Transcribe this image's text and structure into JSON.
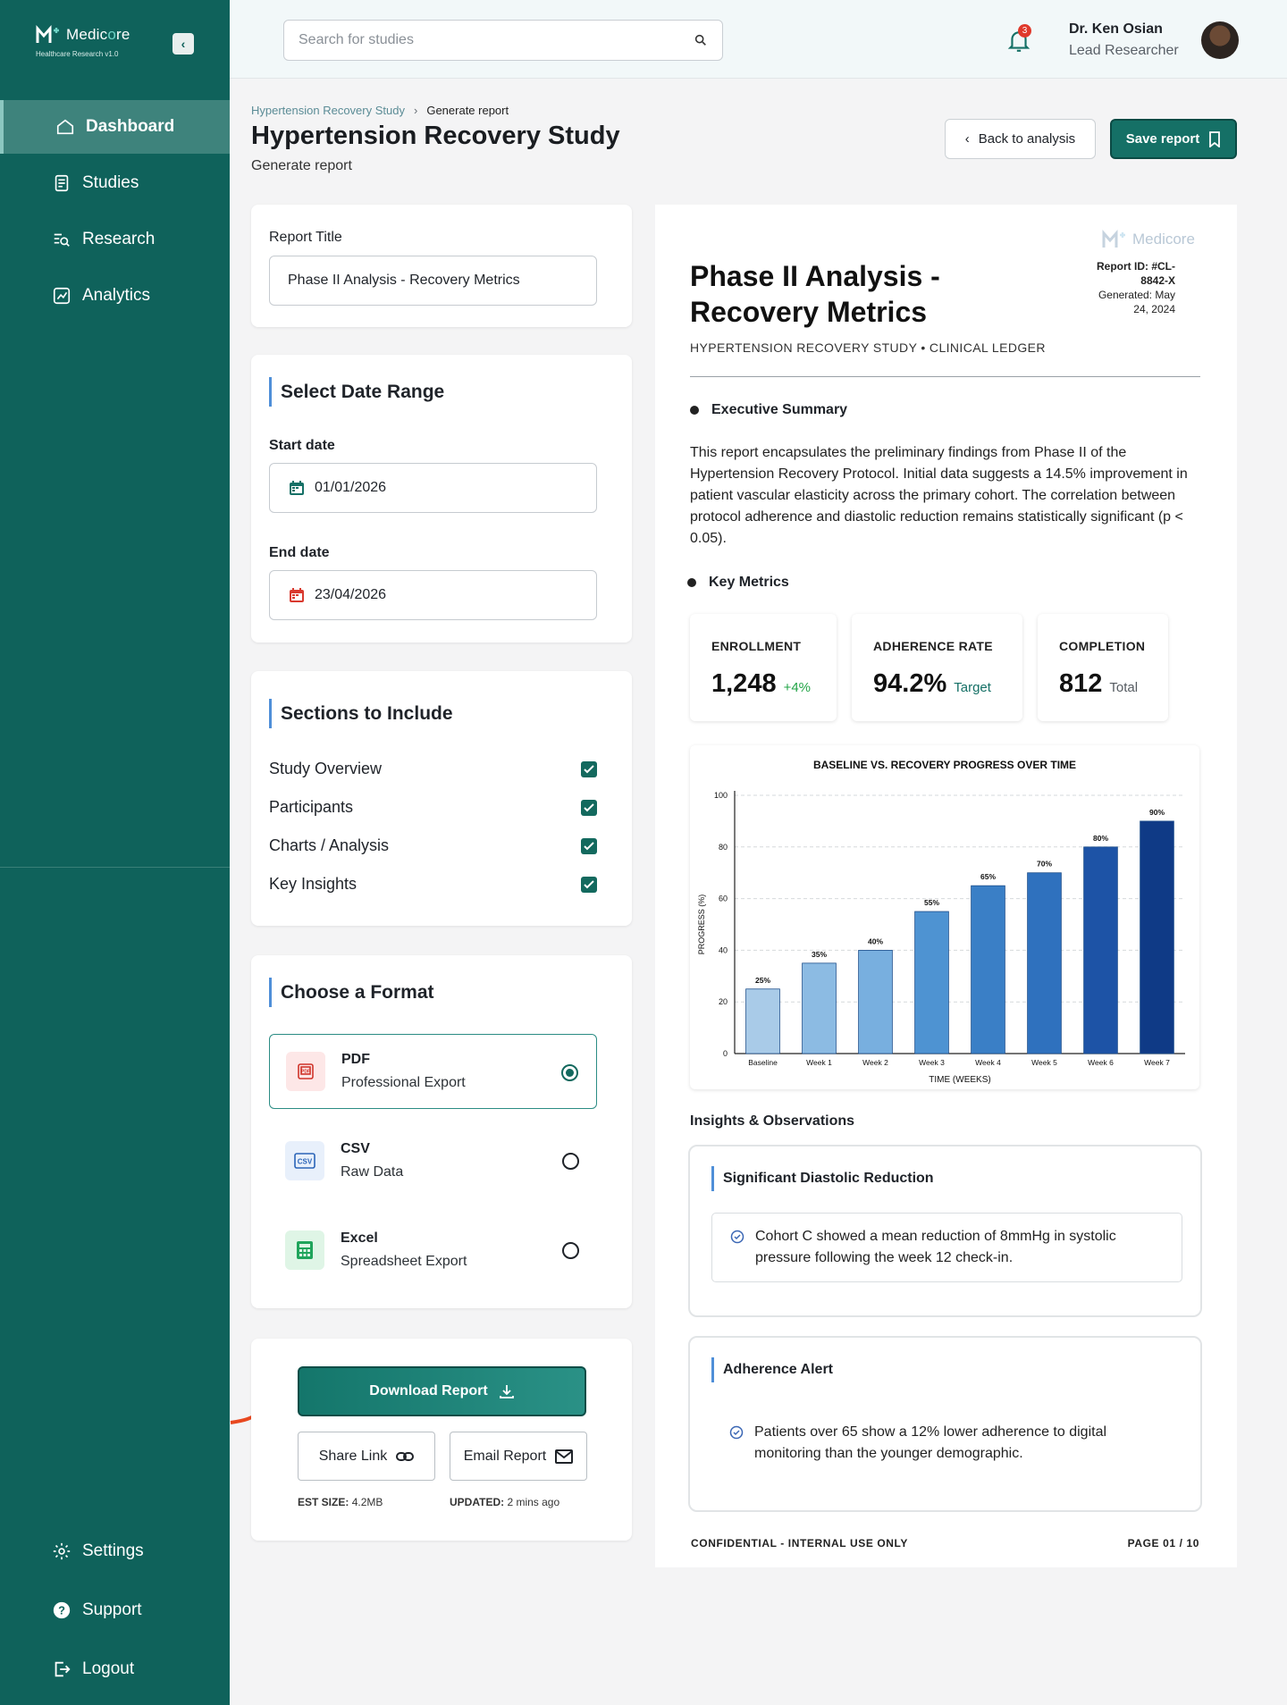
{
  "brand": {
    "name_a": "Medic",
    "name_b": "o",
    "name_c": "re",
    "subtitle": "Healthcare Research v1.0"
  },
  "nav": {
    "main": [
      {
        "label": "Dashboard",
        "icon": "home-icon",
        "active": true
      },
      {
        "label": "Studies",
        "icon": "document-icon"
      },
      {
        "label": "Research",
        "icon": "search-list-icon"
      },
      {
        "label": "Analytics",
        "icon": "analytics-icon"
      }
    ],
    "bottom": [
      {
        "label": "Settings",
        "icon": "gear-icon"
      },
      {
        "label": "Support",
        "icon": "help-icon"
      },
      {
        "label": "Logout",
        "icon": "logout-icon"
      }
    ]
  },
  "header": {
    "search_placeholder": "Search for studies",
    "notification_count": "3",
    "user_name": "Dr. Ken Osian",
    "user_role": "Lead Researcher"
  },
  "page": {
    "breadcrumb": [
      "Hypertension Recovery Study",
      "Generate report"
    ],
    "title": "Hypertension Recovery Study",
    "subtitle": "Generate report",
    "back_label": "Back to analysis",
    "save_label": "Save report"
  },
  "form": {
    "report_title_label": "Report Title",
    "report_title_value": "Phase II Analysis - Recovery Metrics",
    "date_heading": "Select Date Range",
    "start_label": "Start date",
    "start_value": "01/01/2026",
    "end_label": "End date",
    "end_value": "23/04/2026",
    "sections_heading": "Sections to Include",
    "sections": [
      {
        "label": "Study Overview",
        "checked": true
      },
      {
        "label": "Participants",
        "checked": true
      },
      {
        "label": "Charts / Analysis",
        "checked": true
      },
      {
        "label": "Key Insights",
        "checked": true
      }
    ],
    "format_heading": "Choose a Format",
    "formats": [
      {
        "title": "PDF",
        "sub": "Professional Export",
        "selected": true,
        "icon": "pdf-icon"
      },
      {
        "title": "CSV",
        "sub": "Raw Data",
        "selected": false,
        "icon": "csv-icon"
      },
      {
        "title": "Excel",
        "sub": "Spreadsheet Export",
        "selected": false,
        "icon": "excel-icon"
      }
    ],
    "download_label": "Download Report",
    "share_label": "Share Link",
    "email_label": "Email Report",
    "est_size_label": "EST SIZE:",
    "est_size_value": "4.2MB",
    "updated_label": "UPDATED:",
    "updated_value": "2 mins ago"
  },
  "report": {
    "logo_text": "Medicore",
    "report_id": "Report ID: #CL-8842-X",
    "generated": "Generated: May 24, 2024",
    "title": "Phase II Analysis - Recovery Metrics",
    "kicker": "HYPERTENSION RECOVERY STUDY • CLINICAL LEDGER",
    "exec_heading": "Executive Summary",
    "exec_text": "This report encapsulates the preliminary findings from Phase II of the Hypertension Recovery Protocol. Initial data suggests a 14.5% improvement in patient vascular elasticity across the primary cohort. The correlation between protocol adherence and diastolic reduction remains statistically significant (p < 0.05).",
    "metrics_heading": "Key Metrics",
    "metrics": [
      {
        "label": "ENROLLMENT",
        "value": "1,248",
        "note": "+4%",
        "note_color": "#22a447"
      },
      {
        "label": "ADHERENCE RATE",
        "value": "94.2%",
        "note": "Target",
        "note_color": "#157066"
      },
      {
        "label": "COMPLETION",
        "value": "812",
        "note": "Total",
        "note_color": "#555b61"
      }
    ],
    "insights_heading": "Insights & Observations",
    "insights": [
      {
        "title": "Significant Diastolic Reduction",
        "body": "Cohort C showed a mean reduction of 8mmHg in systolic pressure following the week 12 check-in."
      },
      {
        "title": "Adherence Alert",
        "body": "Patients over 65 show a 12% lower adherence to digital monitoring than the younger demographic."
      }
    ],
    "footer_left": "CONFIDENTIAL - INTERNAL USE ONLY",
    "footer_right": "PAGE 01 / 10"
  },
  "chart_data": {
    "type": "bar",
    "title": "BASELINE VS. RECOVERY PROGRESS OVER TIME",
    "xlabel": "TIME (WEEKS)",
    "ylabel": "PROGRESS (%)",
    "categories": [
      "Baseline",
      "Week 1",
      "Week 2",
      "Week 3",
      "Week 4",
      "Week 5",
      "Week 6",
      "Week 7"
    ],
    "values": [
      25,
      35,
      40,
      55,
      65,
      70,
      80,
      90
    ],
    "data_labels": [
      "25%",
      "35%",
      "40%",
      "55%",
      "65%",
      "70%",
      "80%",
      "90%"
    ],
    "ylim": [
      0,
      100
    ],
    "yticks": [
      0,
      20,
      40,
      60,
      80,
      100
    ],
    "grid": true,
    "colors": [
      "#a9cbe8",
      "#8cbbe3",
      "#78afdf",
      "#4e93d2",
      "#3a7fc6",
      "#2f71be",
      "#1d53a6",
      "#0f3a86"
    ]
  }
}
